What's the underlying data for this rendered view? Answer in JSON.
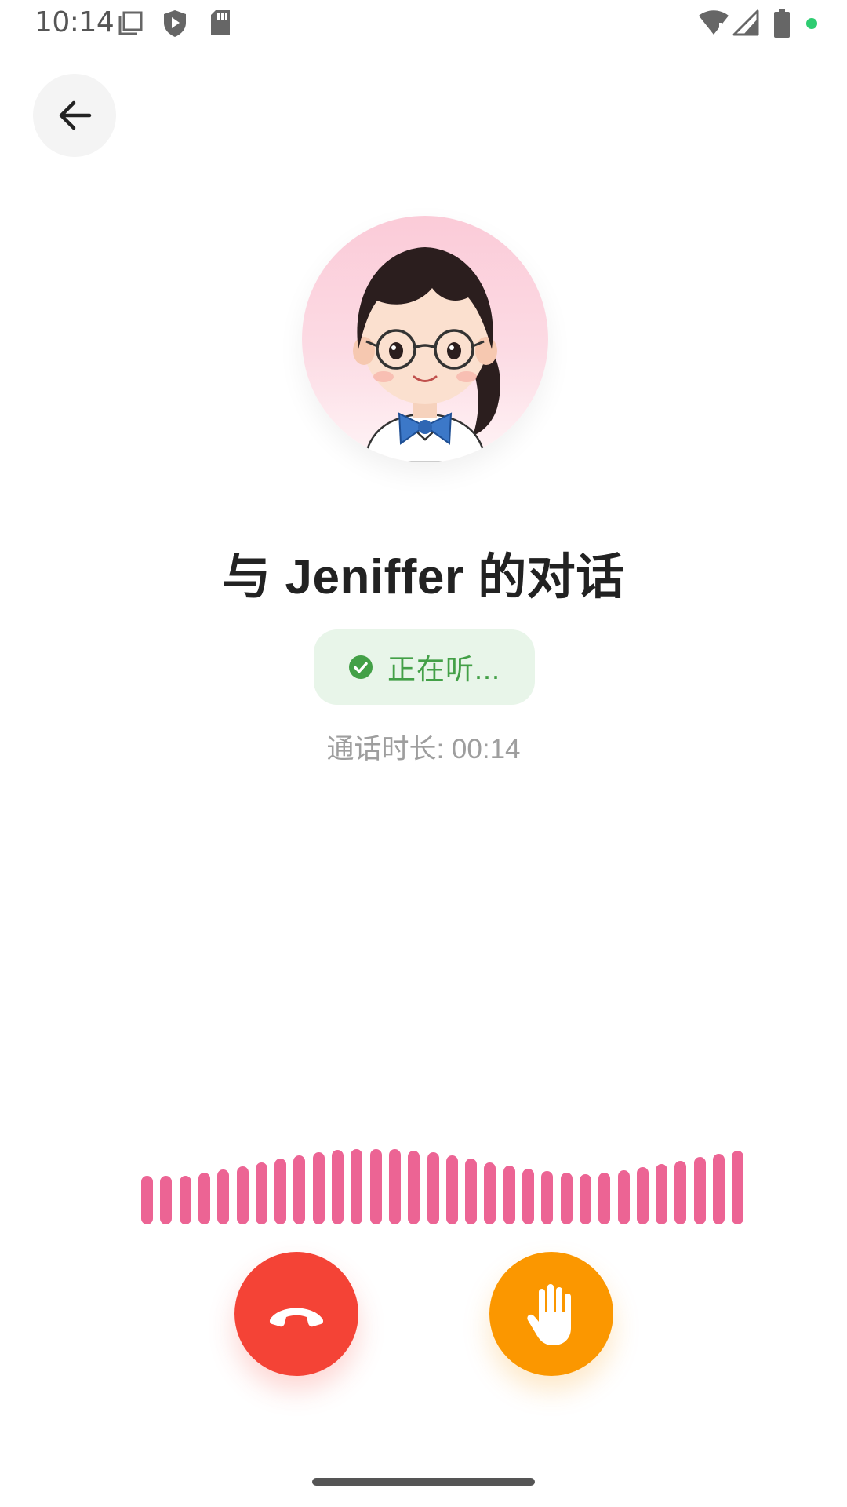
{
  "status_bar": {
    "time": "10:14",
    "icons": [
      "screenshot-icon",
      "shield-play-icon",
      "sd-card-icon",
      "wifi-alert-icon",
      "signal-icon",
      "battery-icon",
      "notification-dot"
    ]
  },
  "header": {
    "back_icon": "arrow-left-icon"
  },
  "call": {
    "title": "与 Jeniffer 的对话",
    "status": "正在听...",
    "status_icon": "check-circle-icon",
    "duration_label": "通话时长: 00:14"
  },
  "waveform": {
    "color": "#ec6494",
    "levels": [
      0.62,
      0.62,
      0.62,
      0.66,
      0.7,
      0.74,
      0.79,
      0.84,
      0.88,
      0.92,
      0.95,
      0.96,
      0.96,
      0.96,
      0.94,
      0.92,
      0.88,
      0.84,
      0.79,
      0.75,
      0.71,
      0.68,
      0.66,
      0.64,
      0.66,
      0.69,
      0.73,
      0.77,
      0.81,
      0.86,
      0.9,
      0.94
    ]
  },
  "controls": {
    "hangup_icon": "phone-hangup-icon",
    "raise_hand_icon": "hand-icon"
  },
  "colors": {
    "hangup": "#f44336",
    "raise_hand": "#fb9700",
    "status_green": "#43a047",
    "status_bg": "#e8f5e9",
    "accent_pink": "#ec6494"
  }
}
